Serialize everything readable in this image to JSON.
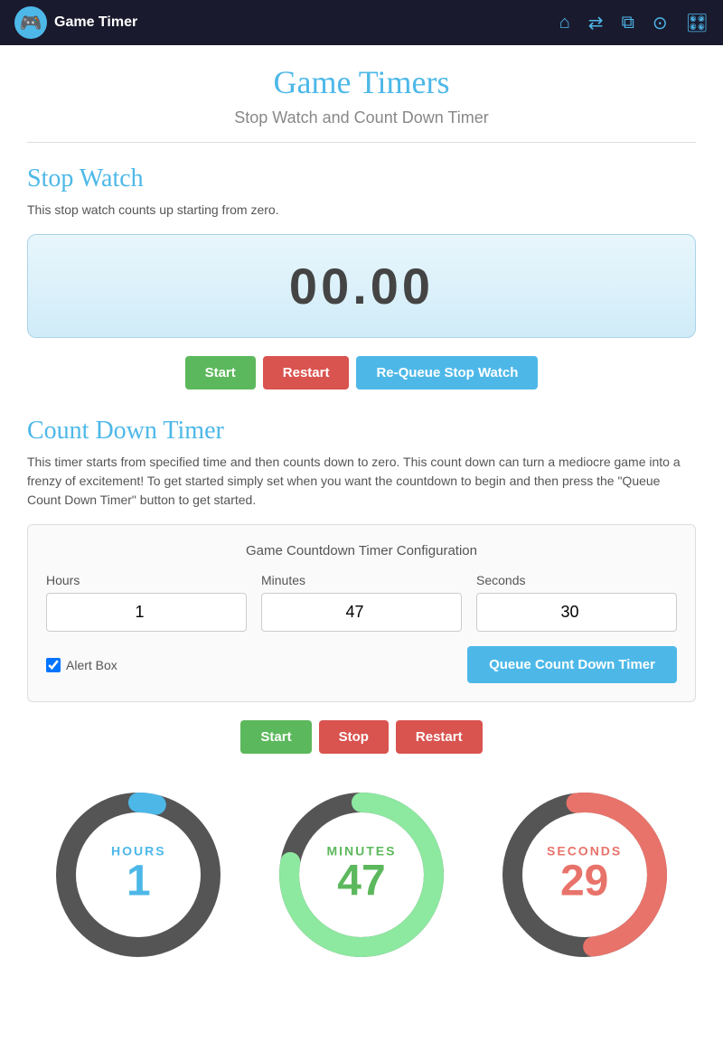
{
  "header": {
    "app_name": "Game Timer",
    "logo_emoji": "🎮"
  },
  "page": {
    "title": "Game Timers",
    "subtitle": "Stop Watch and Count Down Timer"
  },
  "stopwatch": {
    "section_title": "Stop Watch",
    "description": "This stop watch counts up starting from zero.",
    "display": "00.00",
    "btn_start": "Start",
    "btn_restart": "Restart",
    "btn_requeue": "Re-Queue Stop Watch"
  },
  "countdown": {
    "section_title": "Count Down Timer",
    "description": "This timer starts from specified time and then counts down to zero. This count down can turn a mediocre game into a frenzy of excitement! To get started simply set when you want the countdown to begin and then press the \"Queue Count Down Timer\" button to get started.",
    "config_title": "Game Countdown Timer Configuration",
    "hours_label": "Hours",
    "hours_value": "1",
    "minutes_label": "Minutes",
    "minutes_value": "47",
    "seconds_label": "Seconds",
    "seconds_value": "30",
    "alert_label": "Alert Box",
    "btn_queue": "Queue Count Down Timer",
    "btn_start": "Start",
    "btn_stop": "Stop",
    "btn_restart": "Restart"
  },
  "timers": {
    "hours": {
      "label": "HOURS",
      "value": "1",
      "progress": 0.04,
      "color": "#4db8e8",
      "track_color": "#555"
    },
    "minutes": {
      "label": "MINUTES",
      "value": "47",
      "progress": 0.78,
      "color": "#8de8a0",
      "track_color": "#555"
    },
    "seconds": {
      "label": "SECONDS",
      "value": "29",
      "progress": 0.48,
      "color": "#e8736b",
      "track_color": "#555"
    }
  }
}
